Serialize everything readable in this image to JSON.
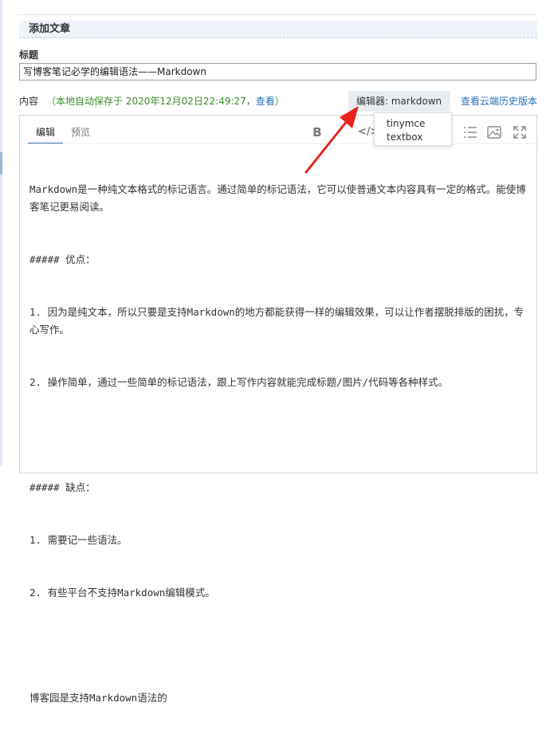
{
  "section": {
    "header": "添加文章"
  },
  "title": {
    "label": "标题",
    "value": "写博客笔记必学的编辑语法——Markdown"
  },
  "content": {
    "label": "内容",
    "autosave_text": "（本地自动保存于 2020年12月02日22:49:27，",
    "view_link": "查看",
    "autosave_close": "）",
    "editor_switch_label": "编辑器: markdown",
    "history_link": "查看云端历史版本"
  },
  "editor": {
    "tabs": [
      {
        "label": "编辑"
      },
      {
        "label": "预览"
      }
    ],
    "toolbar": {
      "bold_label": "B",
      "code_label": "</>"
    },
    "text_lines": [
      "Markdown是一种纯文本格式的标记语言。通过简单的标记语法，它可以使普通文本内容具有一定的格式。能使博客笔记更易阅读。",
      "##### 优点：",
      "1. 因为是纯文本，所以只要是支持Markdown的地方都能获得一样的编辑效果，可以让作者摆脱排版的困扰，专心写作。",
      "2. 操作简单，通过一些简单的标记语法，跟上写作内容就能完成标题/图片/代码等各种样式。",
      "",
      "##### 缺点：",
      "1. 需要记一些语法。",
      "2. 有些平台不支持Markdown编辑模式。",
      "",
      "博客园是支持Markdown语法的"
    ]
  },
  "dropdown": {
    "options": [
      "tinymce",
      "textbox"
    ]
  },
  "colors": {
    "autosave": "#3c8a2e",
    "link": "#2a6ebc",
    "annotation_arrow": "#e8231b"
  },
  "icons": [
    "bold-icon",
    "code-icon",
    "list-icon",
    "image-icon",
    "fullscreen-icon",
    "caret-down-icon"
  ]
}
